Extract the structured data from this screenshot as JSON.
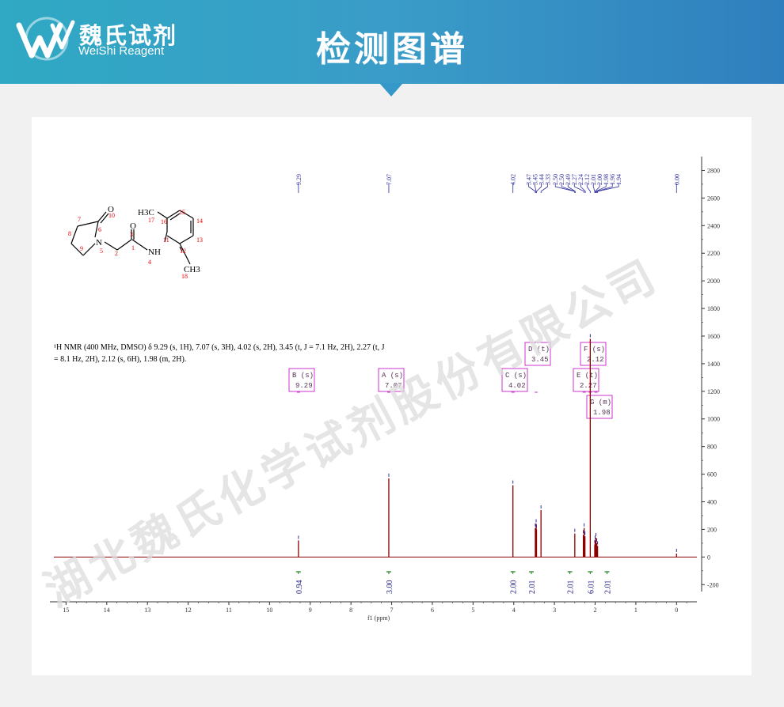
{
  "header": {
    "brand_cn": "魏氏试剂",
    "brand_en": "WeiShi Reagent",
    "title": "检测图谱"
  },
  "watermark": "湖北魏氏化学试剂股份有限公司",
  "molecule_labels": {
    "O_top": "O",
    "n10": "10",
    "n7": "7",
    "n6": "6",
    "n8": "8",
    "N": "N",
    "n5": "5",
    "n9": "9",
    "n2": "2",
    "n1": "1",
    "O_amide": "O",
    "n3": "3",
    "NH": "NH",
    "n4": "4",
    "H3C": "H3C",
    "n17": "17",
    "n16": "16",
    "n15": "15",
    "n14": "14",
    "n13": "13",
    "n12": "12",
    "n11": "11",
    "CH3": "CH3",
    "n18": "18"
  },
  "nmr_text_line1": "¹H NMR (400 MHz, DMSO) δ 9.29 (s, 1H), 7.07 (s, 3H), 4.02 (s, 2H), 3.45 (t, J = 7.1 Hz, 2H), 2.27 (t, J",
  "nmr_text_line2": "= 8.1 Hz, 2H), 2.12 (s, 6H), 1.98 (m, 2H).",
  "chart_data": {
    "type": "line",
    "title": "",
    "xlabel": "f1 (ppm)",
    "ylabel": "",
    "xlim": [
      15.3,
      -0.5
    ],
    "ylim": [
      -250,
      2900
    ],
    "x_ticks": [
      "15",
      "14",
      "13",
      "12",
      "11",
      "10",
      "9",
      "8",
      "7",
      "6",
      "5",
      "4",
      "3",
      "2",
      "1",
      "0"
    ],
    "y_ticks": [
      "-200",
      "0",
      "200",
      "400",
      "600",
      "800",
      "1000",
      "1200",
      "1400",
      "1600",
      "1800",
      "2000",
      "2200",
      "2400",
      "2600",
      "2800"
    ],
    "peaks": [
      {
        "ppm": 9.29,
        "height": 120
      },
      {
        "ppm": 7.07,
        "height": 570
      },
      {
        "ppm": 4.02,
        "height": 520
      },
      {
        "ppm": 3.47,
        "height": 210
      },
      {
        "ppm": 3.45,
        "height": 240
      },
      {
        "ppm": 3.44,
        "height": 200
      },
      {
        "ppm": 3.33,
        "height": 340
      },
      {
        "ppm": 2.5,
        "height": 170
      },
      {
        "ppm": 2.29,
        "height": 160
      },
      {
        "ppm": 2.27,
        "height": 210
      },
      {
        "ppm": 2.25,
        "height": 150
      },
      {
        "ppm": 2.12,
        "height": 1580
      },
      {
        "ppm": 2.01,
        "height": 90
      },
      {
        "ppm": 2.0,
        "height": 120
      },
      {
        "ppm": 1.98,
        "height": 140
      },
      {
        "ppm": 1.96,
        "height": 100
      },
      {
        "ppm": 1.94,
        "height": 80
      },
      {
        "ppm": 0.0,
        "height": 25
      }
    ],
    "peak_labels": [
      "9.29",
      "7.07",
      "4.02",
      "3.47",
      "3.45",
      "3.44",
      "3.33",
      "2.50",
      "2.50",
      "2.49",
      "2.27",
      "2.24",
      "2.12",
      "2.01",
      "2.00",
      "1.98",
      "1.96",
      "1.94",
      "0.00"
    ],
    "multiplets": [
      {
        "label": "B (s)",
        "shift": "9.29",
        "ppm": 9.29
      },
      {
        "label": "A (s)",
        "shift": "7.07",
        "ppm": 7.07
      },
      {
        "label": "C (s)",
        "shift": "4.02",
        "ppm": 4.02
      },
      {
        "label": "D (t)",
        "shift": "3.45",
        "ppm": 3.45
      },
      {
        "label": "E (t)",
        "shift": "2.27",
        "ppm": 2.27
      },
      {
        "label": "F (s)",
        "shift": "2.12",
        "ppm": 2.12
      },
      {
        "label": "G (m)",
        "shift": "1.98",
        "ppm": 1.98
      }
    ],
    "integrals": [
      {
        "value": "0.94",
        "ppm": 9.29
      },
      {
        "value": "3.00",
        "ppm": 7.07
      },
      {
        "value": "2.00",
        "ppm": 4.02
      },
      {
        "value": "2.01",
        "ppm": 3.45
      },
      {
        "value": "2.01",
        "ppm": 2.27
      },
      {
        "value": "6.01",
        "ppm": 2.12
      },
      {
        "value": "2.01",
        "ppm": 1.98
      }
    ],
    "colors": {
      "spectrum": "#8b0000",
      "peak_label": "#2e2e9e",
      "multiplet": "#cc33cc",
      "integral": "#1a7a1a",
      "axis": "#333333"
    }
  }
}
